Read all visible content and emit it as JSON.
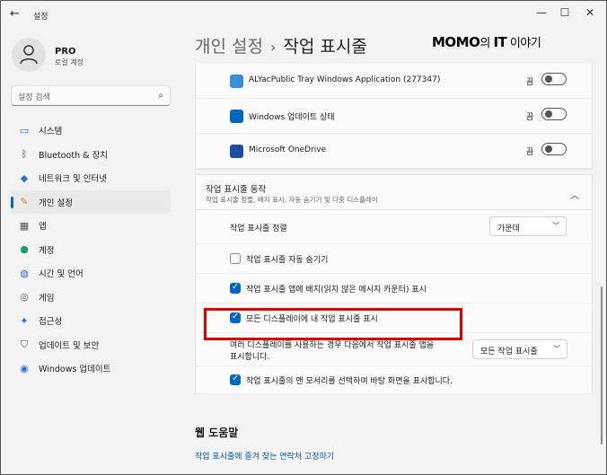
{
  "window": {
    "title": "설정"
  },
  "profile": {
    "name": "PRO",
    "account": "로컬 계정"
  },
  "search": {
    "placeholder": "설정 검색"
  },
  "nav": [
    {
      "label": "시스템",
      "icon": "monitor-icon",
      "color": "#2a6fd6"
    },
    {
      "label": "Bluetooth & 장치",
      "icon": "bluetooth-icon",
      "color": "#444444"
    },
    {
      "label": "네트워크 및 인터넷",
      "icon": "wifi-icon",
      "color": "#2a6fd6"
    },
    {
      "label": "개인 설정",
      "icon": "brush-icon",
      "color": "#c08a3a"
    },
    {
      "label": "앱",
      "icon": "apps-icon",
      "color": "#555555"
    },
    {
      "label": "계정",
      "icon": "person-icon",
      "color": "#1a9d6b"
    },
    {
      "label": "시간 및 언어",
      "icon": "globe-icon",
      "color": "#2a6fd6"
    },
    {
      "label": "게임",
      "icon": "gamepad-icon",
      "color": "#555555"
    },
    {
      "label": "접근성",
      "icon": "accessibility-icon",
      "color": "#2a6fd6"
    },
    {
      "label": "업데이트 및 보안",
      "icon": "shield-icon",
      "color": "#555555"
    },
    {
      "label": "Windows 업데이트",
      "icon": "update-icon",
      "color": "#2a6fd6"
    }
  ],
  "header": {
    "crumb1": "개인 설정",
    "separator": "›",
    "crumb2": "작업 표시줄"
  },
  "watermark": {
    "brand": "MOMO",
    "mid": "의 ",
    "it": "IT",
    "tail": " 이야기"
  },
  "tray_apps": [
    {
      "label": "ALYacPublic Tray Windows Application (277347)",
      "state": "끔",
      "icon": "alyac-icon",
      "color": "#3a8fd6"
    },
    {
      "label": "Windows 업데이트 상태",
      "state": "끔",
      "icon": "windows-update-icon",
      "color": "#0067c0"
    },
    {
      "label": "Microsoft OneDrive",
      "state": "끔",
      "icon": "onedrive-icon",
      "color": "#1d4fa0"
    }
  ],
  "behavior": {
    "title": "작업 표시줄 동작",
    "subtitle": "작업 표시줄 정렬, 배지 표시, 자동 숨기기 및 다중 디스플레이",
    "alignment_label": "작업 표시줄 정렬",
    "alignment_value": "가운데",
    "autohide_label": "작업 표시줄 자동 숨기기",
    "badge_label": "작업 표시줄 앱에 배지(읽지 않은 메시지 카운터) 표시",
    "all_displays_label": "모든 디스플레이에 내 작업 표시줄 표시",
    "multi_label_1": "여러 디스플레이를 사용하는 경우 다음에서 작업 표시줄 앱을",
    "multi_label_2": "표시합니다.",
    "multi_value": "모든 작업 표시줄",
    "corner_label": "작업 표시줄의 맨 모서리를 선택하여 바탕 화면을 표시합니다."
  },
  "help": {
    "title": "웹 도움말",
    "link": "작업 표시줄에 즐겨 찾는 연락처 고정하기"
  },
  "colors": {
    "accent": "#0067c0",
    "highlight": "#e00000"
  }
}
